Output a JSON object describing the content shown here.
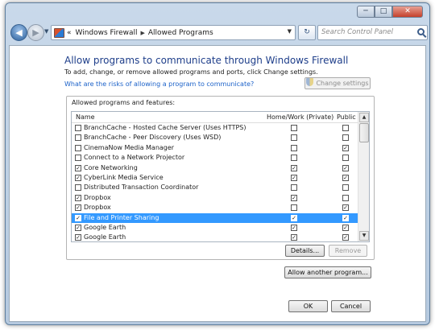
{
  "window": {
    "minimize_label": "─",
    "maximize_label": "□",
    "close_label": "✕"
  },
  "nav": {
    "back_label": "◀",
    "forward_label": "▶",
    "breadcrumb_lead": "«",
    "breadcrumb_1": "Windows Firewall",
    "breadcrumb_2": "Allowed Programs",
    "search_placeholder": "Search Control Panel"
  },
  "main": {
    "heading": "Allow programs to communicate through Windows Firewall",
    "subtext": "To add, change, or remove allowed programs and ports, click Change settings.",
    "risk_link": "What are the risks of allowing a program to communicate?",
    "change_settings_label": "Change settings"
  },
  "group": {
    "label": "Allowed programs and features:",
    "columns": {
      "name": "Name",
      "home": "Home/Work (Private)",
      "public": "Public"
    },
    "rows": [
      {
        "name": "BranchCache - Hosted Cache Server (Uses HTTPS)",
        "enabled": false,
        "home": false,
        "public": false,
        "selected": false
      },
      {
        "name": "BranchCache - Peer Discovery (Uses WSD)",
        "enabled": false,
        "home": false,
        "public": false,
        "selected": false
      },
      {
        "name": "CinemaNow Media Manager",
        "enabled": false,
        "home": false,
        "public": true,
        "selected": false
      },
      {
        "name": "Connect to a Network Projector",
        "enabled": false,
        "home": false,
        "public": false,
        "selected": false
      },
      {
        "name": "Core Networking",
        "enabled": true,
        "home": true,
        "public": true,
        "selected": false
      },
      {
        "name": "CyberLink Media Service",
        "enabled": true,
        "home": true,
        "public": true,
        "selected": false
      },
      {
        "name": "Distributed Transaction Coordinator",
        "enabled": false,
        "home": false,
        "public": false,
        "selected": false
      },
      {
        "name": "Dropbox",
        "enabled": true,
        "home": true,
        "public": false,
        "selected": false
      },
      {
        "name": "Dropbox",
        "enabled": true,
        "home": false,
        "public": true,
        "selected": false
      },
      {
        "name": "File and Printer Sharing",
        "enabled": true,
        "home": true,
        "public": true,
        "selected": true
      },
      {
        "name": "Google Earth",
        "enabled": true,
        "home": true,
        "public": true,
        "selected": false
      },
      {
        "name": "Google Earth",
        "enabled": true,
        "home": true,
        "public": true,
        "selected": false
      }
    ],
    "details_label": "Details...",
    "remove_label": "Remove"
  },
  "allow_another_label": "Allow another program...",
  "ok_label": "OK",
  "cancel_label": "Cancel"
}
